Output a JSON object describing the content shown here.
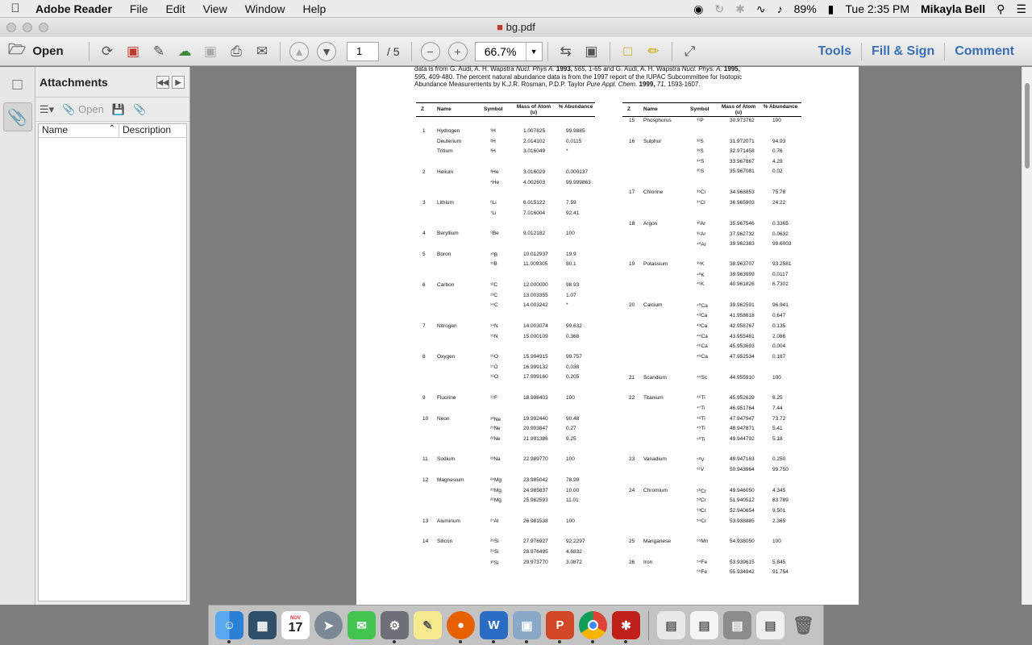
{
  "menubar": {
    "app_name": "Adobe Reader",
    "items": [
      "File",
      "Edit",
      "View",
      "Window",
      "Help"
    ],
    "battery": "89%",
    "clock": "Tue 2:35 PM",
    "user": "Mikayla Bell"
  },
  "window": {
    "title": "bg.pdf"
  },
  "toolbar": {
    "open_label": "Open",
    "page_current": "1",
    "page_total": "/ 5",
    "zoom_value": "66.7%",
    "tools_label": "Tools",
    "fill_sign_label": "Fill & Sign",
    "comment_label": "Comment"
  },
  "attachments": {
    "title": "Attachments",
    "open_label": "Open",
    "columns": {
      "name": "Name",
      "description": "Description"
    }
  },
  "document": {
    "intro_line1": "data is from G. Audi, A. H. Wapstra ",
    "intro_j1": "Nucl. Phys A.",
    "intro_line1b": " 1993, ",
    "intro_v1": "565",
    "intro_line1c": ", 1-65 and G. Audi, A. H. Wapstra ",
    "intro_j2": "Nucl. Phys. A.",
    "intro_line1d": " 1995,",
    "intro_v2": "595",
    "intro_line2": ", 409-480.  The percent natural abundance data is from the 1997 report of the IUPAC Subcommittee for Isotopic",
    "intro_line3a": "Abundance Measurements by K.J.R. Rosman, P.D.P. Taylor ",
    "intro_j3": "Pure Appl. Chem.",
    "intro_line3b": " 1999, ",
    "intro_v3": "71",
    "intro_line3c": ", 1593-1607.",
    "headers": {
      "z": "Z",
      "name": "Name",
      "symbol": "Symbol",
      "mass": "Mass of Atom (u)",
      "abundance": "% Abundance"
    },
    "left_rows": [
      {
        "z": "1",
        "name": "Hydrogen",
        "sym": "¹H",
        "mass": "1.007825",
        "ab": "99.9885"
      },
      {
        "z": "",
        "name": "Deuterium",
        "sym": "²H",
        "mass": "2.014102",
        "ab": "0.0115"
      },
      {
        "z": "",
        "name": "Tritium",
        "sym": "³H",
        "mass": "3.016049",
        "ab": "*"
      },
      {
        "z": "2",
        "name": "Helium",
        "sym": "³He",
        "mass": "3.016029",
        "ab": "0.000137"
      },
      {
        "z": "",
        "name": "",
        "sym": "⁴He",
        "mass": "4.002603",
        "ab": "99.999863"
      },
      {
        "z": "3",
        "name": "Lithium",
        "sym": "⁶Li",
        "mass": "6.015122",
        "ab": "7.59"
      },
      {
        "z": "",
        "name": "",
        "sym": "⁷Li",
        "mass": "7.016004",
        "ab": "92.41"
      },
      {
        "z": "4",
        "name": "Beryllium",
        "sym": "⁹Be",
        "mass": "9.012182",
        "ab": "100"
      },
      {
        "z": "5",
        "name": "Boron",
        "sym": "¹⁰B",
        "mass": "10.012937",
        "ab": "19.9"
      },
      {
        "z": "",
        "name": "",
        "sym": "¹¹B",
        "mass": "11.009305",
        "ab": "80.1"
      },
      {
        "z": "6",
        "name": "Carbon",
        "sym": "¹²C",
        "mass": "12.000000",
        "ab": "98.93"
      },
      {
        "z": "",
        "name": "",
        "sym": "¹³C",
        "mass": "13.003355",
        "ab": "1.07"
      },
      {
        "z": "",
        "name": "",
        "sym": "¹⁴C",
        "mass": "14.003242",
        "ab": "*"
      },
      {
        "z": "7",
        "name": "Nitrogen",
        "sym": "¹⁴N",
        "mass": "14.003074",
        "ab": "99.632"
      },
      {
        "z": "",
        "name": "",
        "sym": "¹⁵N",
        "mass": "15.000109",
        "ab": "0.368"
      },
      {
        "z": "8",
        "name": "Oxygen",
        "sym": "¹⁶O",
        "mass": "15.994915",
        "ab": "99.757"
      },
      {
        "z": "",
        "name": "",
        "sym": "¹⁷O",
        "mass": "16.999132",
        "ab": "0.038"
      },
      {
        "z": "",
        "name": "",
        "sym": "¹⁸O",
        "mass": "17.999160",
        "ab": "0.205"
      },
      {
        "z": "9",
        "name": "Fluorine",
        "sym": "¹⁹F",
        "mass": "18.998403",
        "ab": "100"
      },
      {
        "z": "10",
        "name": "Neon",
        "sym": "²⁰Ne",
        "mass": "19.992440",
        "ab": "90.48"
      },
      {
        "z": "",
        "name": "",
        "sym": "²¹Ne",
        "mass": "20.993847",
        "ab": "0.27"
      },
      {
        "z": "",
        "name": "",
        "sym": "²²Ne",
        "mass": "21.991386",
        "ab": "9.25"
      },
      {
        "z": "11",
        "name": "Sodium",
        "sym": "²³Na",
        "mass": "22.989770",
        "ab": "100"
      },
      {
        "z": "12",
        "name": "Magnesium",
        "sym": "²⁴Mg",
        "mass": "23.985042",
        "ab": "78.99"
      },
      {
        "z": "",
        "name": "",
        "sym": "²⁵Mg",
        "mass": "24.985837",
        "ab": "10.00"
      },
      {
        "z": "",
        "name": "",
        "sym": "²⁶Mg",
        "mass": "25.982593",
        "ab": "11.01"
      },
      {
        "z": "13",
        "name": "Aluminum",
        "sym": "²⁷Al",
        "mass": "26.981538",
        "ab": "100"
      },
      {
        "z": "14",
        "name": "Silicon",
        "sym": "²⁸Si",
        "mass": "27.976927",
        "ab": "92.2297"
      },
      {
        "z": "",
        "name": "",
        "sym": "²⁹Si",
        "mass": "28.976495",
        "ab": "4.6832"
      },
      {
        "z": "",
        "name": "",
        "sym": "³⁰Si",
        "mass": "29.973770",
        "ab": "3.0872"
      }
    ],
    "right_rows": [
      {
        "z": "15",
        "name": "Phosphorus",
        "sym": "³¹P",
        "mass": "30.973762",
        "ab": "100"
      },
      {
        "z": "16",
        "name": "Sulphur",
        "sym": "³²S",
        "mass": "31.972071",
        "ab": "94.93"
      },
      {
        "z": "",
        "name": "",
        "sym": "³³S",
        "mass": "32.971458",
        "ab": "0.76"
      },
      {
        "z": "",
        "name": "",
        "sym": "³⁴S",
        "mass": "33.967867",
        "ab": "4.29"
      },
      {
        "z": "",
        "name": "",
        "sym": "³⁶S",
        "mass": "35.967081",
        "ab": "0.02"
      },
      {
        "z": "17",
        "name": "Chlorine",
        "sym": "³⁵Cl",
        "mass": "34.968853",
        "ab": "75.78"
      },
      {
        "z": "",
        "name": "",
        "sym": "³⁷Cl",
        "mass": "36.965903",
        "ab": "24.22"
      },
      {
        "z": "18",
        "name": "Argon",
        "sym": "³⁶Ar",
        "mass": "35.967546",
        "ab": "0.3365"
      },
      {
        "z": "",
        "name": "",
        "sym": "³⁸Ar",
        "mass": "37.962732",
        "ab": "0.0632"
      },
      {
        "z": "",
        "name": "",
        "sym": "⁴⁰Ar",
        "mass": "39.962383",
        "ab": "99.6003"
      },
      {
        "z": "19",
        "name": "Potassium",
        "sym": "³⁹K",
        "mass": "38.963707",
        "ab": "93.2581"
      },
      {
        "z": "",
        "name": "",
        "sym": "⁴⁰K",
        "mass": "39.963999",
        "ab": "0.0117"
      },
      {
        "z": "",
        "name": "",
        "sym": "⁴¹K",
        "mass": "40.961826",
        "ab": "6.7302"
      },
      {
        "z": "20",
        "name": "Calcium",
        "sym": "⁴⁰Ca",
        "mass": "39.962591",
        "ab": "96.941"
      },
      {
        "z": "",
        "name": "",
        "sym": "⁴²Ca",
        "mass": "41.958618",
        "ab": "0.647"
      },
      {
        "z": "",
        "name": "",
        "sym": "⁴³Ca",
        "mass": "42.958767",
        "ab": "0.135"
      },
      {
        "z": "",
        "name": "",
        "sym": "⁴⁴Ca",
        "mass": "43.955481",
        "ab": "2.086"
      },
      {
        "z": "",
        "name": "",
        "sym": "⁴⁶Ca",
        "mass": "45.953693",
        "ab": "0.004"
      },
      {
        "z": "",
        "name": "",
        "sym": "⁴⁸Ca",
        "mass": "47.952534",
        "ab": "0.187"
      },
      {
        "z": "21",
        "name": "Scandium",
        "sym": "⁴⁵Sc",
        "mass": "44.955910",
        "ab": "100"
      },
      {
        "z": "22",
        "name": "Titanium",
        "sym": "⁴⁶Ti",
        "mass": "45.952629",
        "ab": "8.25"
      },
      {
        "z": "",
        "name": "",
        "sym": "⁴⁷Ti",
        "mass": "46.951764",
        "ab": "7.44"
      },
      {
        "z": "",
        "name": "",
        "sym": "⁴⁸Ti",
        "mass": "47.947947",
        "ab": "73.72"
      },
      {
        "z": "",
        "name": "",
        "sym": "⁴⁹Ti",
        "mass": "48.947871",
        "ab": "5.41"
      },
      {
        "z": "",
        "name": "",
        "sym": "⁵⁰Ti",
        "mass": "49.944792",
        "ab": "5.18"
      },
      {
        "z": "23",
        "name": "Vanadium",
        "sym": "⁵⁰V",
        "mass": "49.947163",
        "ab": "0.250"
      },
      {
        "z": "",
        "name": "",
        "sym": "⁵¹V",
        "mass": "50.943964",
        "ab": "99.750"
      },
      {
        "z": "24",
        "name": "Chromium",
        "sym": "⁵⁰Cr",
        "mass": "49.946050",
        "ab": "4.345"
      },
      {
        "z": "",
        "name": "",
        "sym": "⁵²Cr",
        "mass": "51.940512",
        "ab": "83.789"
      },
      {
        "z": "",
        "name": "",
        "sym": "⁵³Cr",
        "mass": "52.940654",
        "ab": "9.501"
      },
      {
        "z": "",
        "name": "",
        "sym": "⁵⁴Cr",
        "mass": "53.938885",
        "ab": "2.365"
      },
      {
        "z": "25",
        "name": "Manganese",
        "sym": "⁵⁵Mn",
        "mass": "54.938050",
        "ab": "100"
      },
      {
        "z": "26",
        "name": "Iron",
        "sym": "⁵⁴Fe",
        "mass": "53.939615",
        "ab": "5.845"
      },
      {
        "z": "",
        "name": "",
        "sym": "⁵⁶Fe",
        "mass": "55.934942",
        "ab": "91.754"
      }
    ]
  },
  "dock": {
    "calendar_month": "NOV",
    "calendar_day": "17",
    "apps": [
      "finder-icon",
      "dashboard-icon",
      "calendar-icon",
      "launchpad-icon",
      "messages-icon",
      "system-preferences-icon",
      "stickies-icon",
      "firefox-icon",
      "word-icon",
      "preview-icon",
      "powerpoint-icon",
      "chrome-icon",
      "acrobat-icon"
    ],
    "right_items": [
      "documents-stack-icon",
      "downloads-stack-icon",
      "applications-stack-icon",
      "screenshots-stack-icon",
      "trash-icon"
    ]
  }
}
